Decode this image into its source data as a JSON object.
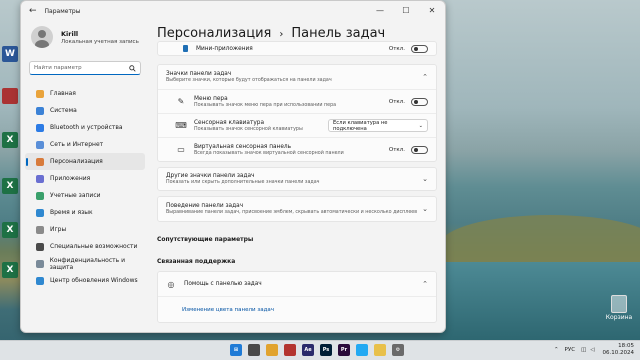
{
  "window": {
    "title": "Параметры",
    "back_glyph": "←",
    "min": "—",
    "max": "☐",
    "close": "✕"
  },
  "user": {
    "name": "Kirill",
    "account": "Локальная учетная запись"
  },
  "search": {
    "placeholder": "Найти параметр",
    "icon": "search-icon"
  },
  "nav": [
    {
      "label": "Главная",
      "color": "#e9a33b"
    },
    {
      "label": "Система",
      "color": "#3b82d6"
    },
    {
      "label": "Bluetooth и устройства",
      "color": "#2c7be5"
    },
    {
      "label": "Сеть и Интернет",
      "color": "#5a8fd8"
    },
    {
      "label": "Персонализация",
      "color": "#d87b3b"
    },
    {
      "label": "Приложения",
      "color": "#6a6fd1"
    },
    {
      "label": "Учетные записи",
      "color": "#3aa06b"
    },
    {
      "label": "Время и язык",
      "color": "#2f88d0"
    },
    {
      "label": "Игры",
      "color": "#8a8a8a"
    },
    {
      "label": "Специальные возможности",
      "color": "#4a4a4a"
    },
    {
      "label": "Конфиденциальность и защита",
      "color": "#7a8a99"
    },
    {
      "label": "Центр обновления Windows",
      "color": "#2f88d0"
    }
  ],
  "active_nav": "Персонализация",
  "breadcrumb": {
    "parent": "Персонализация",
    "sep": "›",
    "current": "Панель задач"
  },
  "widgets_row": {
    "title": "Мини-приложения",
    "state": "Откл."
  },
  "corner_icons": {
    "title": "Значки панели задач",
    "subtitle": "Выберите значки, которые будут отображаться на панели задач",
    "items": [
      {
        "title": "Меню пера",
        "subtitle": "Показывать значок меню пера при использовании пера",
        "state": "Откл."
      },
      {
        "title": "Сенсорная клавиатура",
        "subtitle": "Показывать значок сенсорной клавиатуры",
        "select": "Если клавиатура не подключена"
      },
      {
        "title": "Виртуальная сенсорная панель",
        "subtitle": "Всегда показывать значок виртуальной сенсорной панели",
        "state": "Откл."
      }
    ]
  },
  "other_icons": {
    "title": "Другие значки панели задач",
    "subtitle": "Показать или скрыть дополнительные значки панели задач"
  },
  "behaviors": {
    "title": "Поведение панели задач",
    "subtitle": "Выравнивание панели задач, присвоение эмблем, скрывать автоматически и несколько дисплеев"
  },
  "related": {
    "heading": "Сопутствующие параметры"
  },
  "support": {
    "heading": "Связанная поддержка",
    "help_title": "Помощь с панелью задач",
    "link": "Изменение цвета панели задач"
  },
  "desktop": {
    "recycle_bin": "Корзина"
  },
  "tray": {
    "lang": "РУС",
    "time": "18:05",
    "date": "06.10.2024"
  }
}
